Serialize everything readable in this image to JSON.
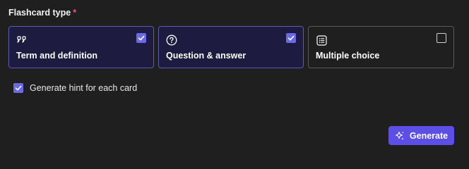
{
  "form": {
    "section_label": "Flashcard type",
    "required_marker": "*"
  },
  "cards": [
    {
      "label": "Term and definition",
      "icon": "quote-icon",
      "selected": true
    },
    {
      "label": "Question & answer",
      "icon": "question-circle-icon",
      "selected": true
    },
    {
      "label": "Multiple choice",
      "icon": "list-box-icon",
      "selected": false
    }
  ],
  "hint": {
    "label": "Generate hint for each card",
    "checked": true
  },
  "actions": {
    "generate_label": "Generate",
    "generate_icon": "sparkle-icon"
  },
  "colors": {
    "accent": "#6a6ae6",
    "button": "#5b4fe6",
    "selected_card_bg": "#1d1b40",
    "selected_card_border": "#5b5bb3",
    "required": "#f0556a",
    "background": "#1f1f1f"
  }
}
